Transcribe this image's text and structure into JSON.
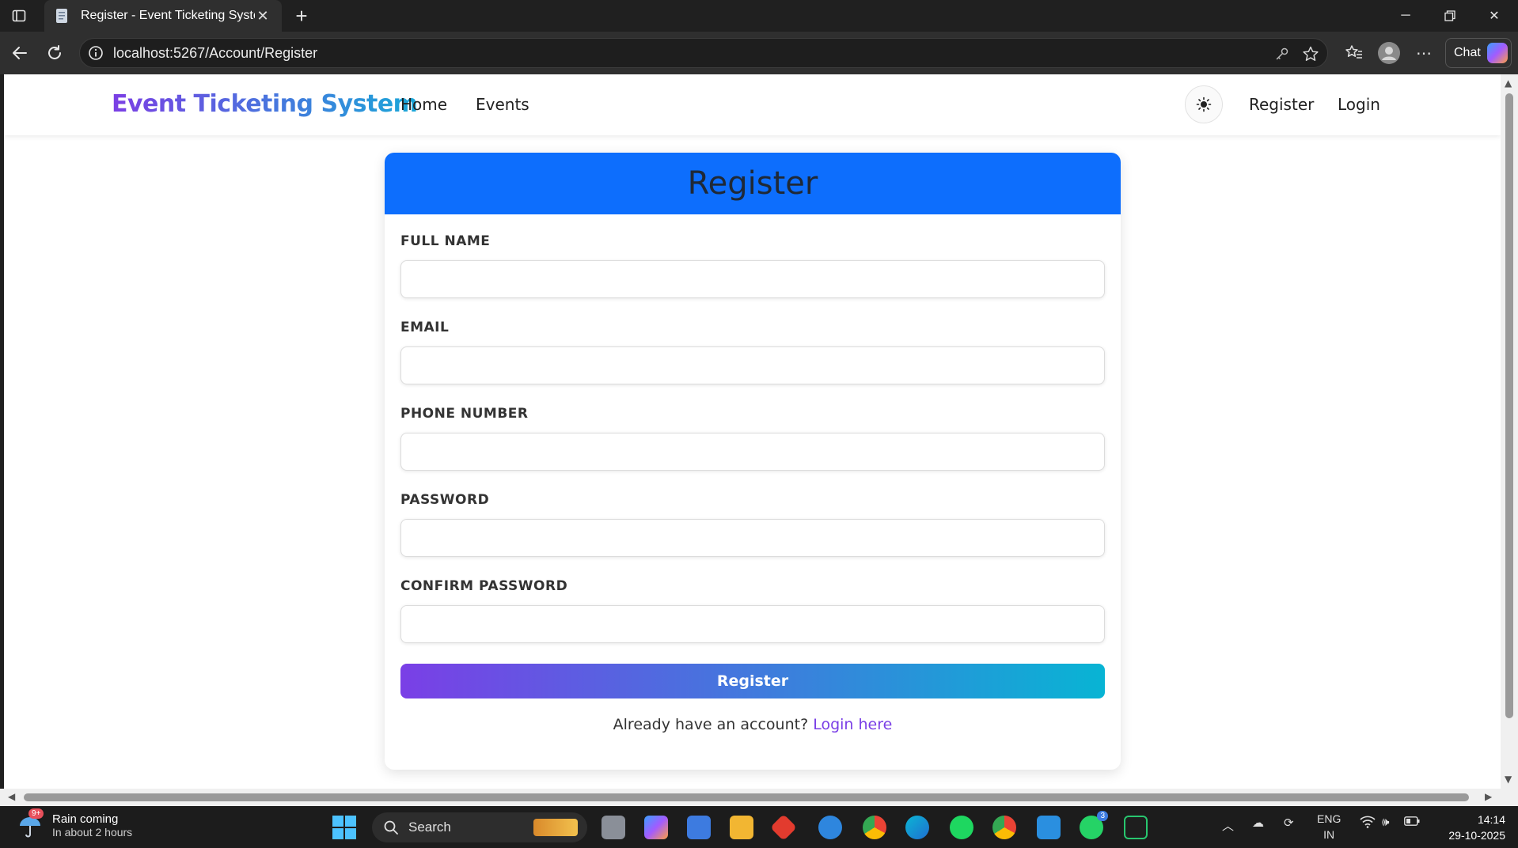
{
  "browser": {
    "tab_title": "Register - Event Ticketing System",
    "url": "localhost:5267/Account/Register",
    "chat_label": "Chat"
  },
  "navbar": {
    "brand": "Event Ticketing System",
    "links": [
      "Home",
      "Events"
    ],
    "right_links": [
      "Register",
      "Login"
    ]
  },
  "form": {
    "heading": "Register",
    "fields": [
      {
        "label": "FULL NAME",
        "value": ""
      },
      {
        "label": "EMAIL",
        "value": ""
      },
      {
        "label": "PHONE NUMBER",
        "value": ""
      },
      {
        "label": "PASSWORD",
        "value": ""
      },
      {
        "label": "CONFIRM PASSWORD",
        "value": ""
      }
    ],
    "submit_label": "Register",
    "footer_text": "Already have an account?",
    "footer_link": "Login here"
  },
  "colors": {
    "header_blue": "#0d6efd",
    "gradient_start": "#7a3fe6",
    "gradient_end": "#08b4d4",
    "link_purple": "#7a3fe6"
  },
  "taskbar": {
    "weather_badge": "9+",
    "weather_title": "Rain coming",
    "weather_sub": "In about 2 hours",
    "search_label": "Search",
    "lang_1": "ENG",
    "lang_2": "IN",
    "time": "14:14",
    "date": "29-10-2025",
    "whatsapp_badge": "3"
  }
}
